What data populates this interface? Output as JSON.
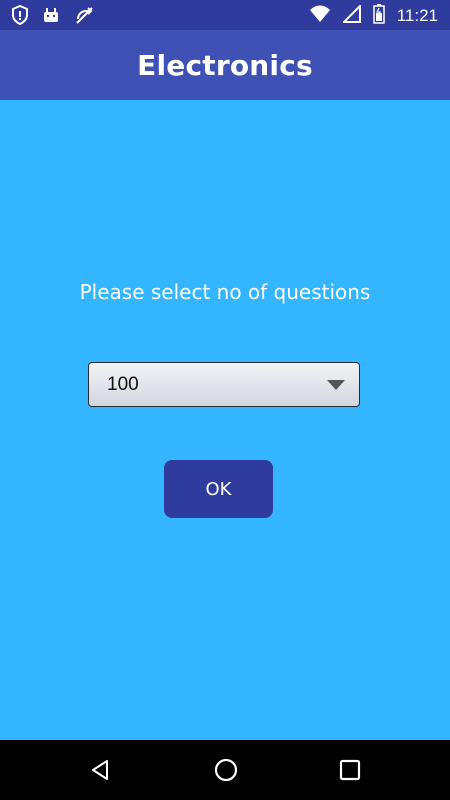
{
  "status_bar": {
    "time": "11:21",
    "icons": [
      "shield-icon",
      "android-icon",
      "no-sync-icon",
      "wifi-icon",
      "signal-icon",
      "battery-icon"
    ]
  },
  "app_bar": {
    "title": "Electronics"
  },
  "main": {
    "prompt": "Please select no of questions",
    "select": {
      "value": "100"
    },
    "ok_label": "OK"
  },
  "nav_bar": {
    "icons": [
      "back-icon",
      "home-icon",
      "recents-icon"
    ]
  },
  "colors": {
    "background": "#33b5ff",
    "status_bar": "#2f3c9e",
    "app_bar": "#3f51b5",
    "button": "#2f3c9e",
    "nav_bar": "#000000"
  }
}
